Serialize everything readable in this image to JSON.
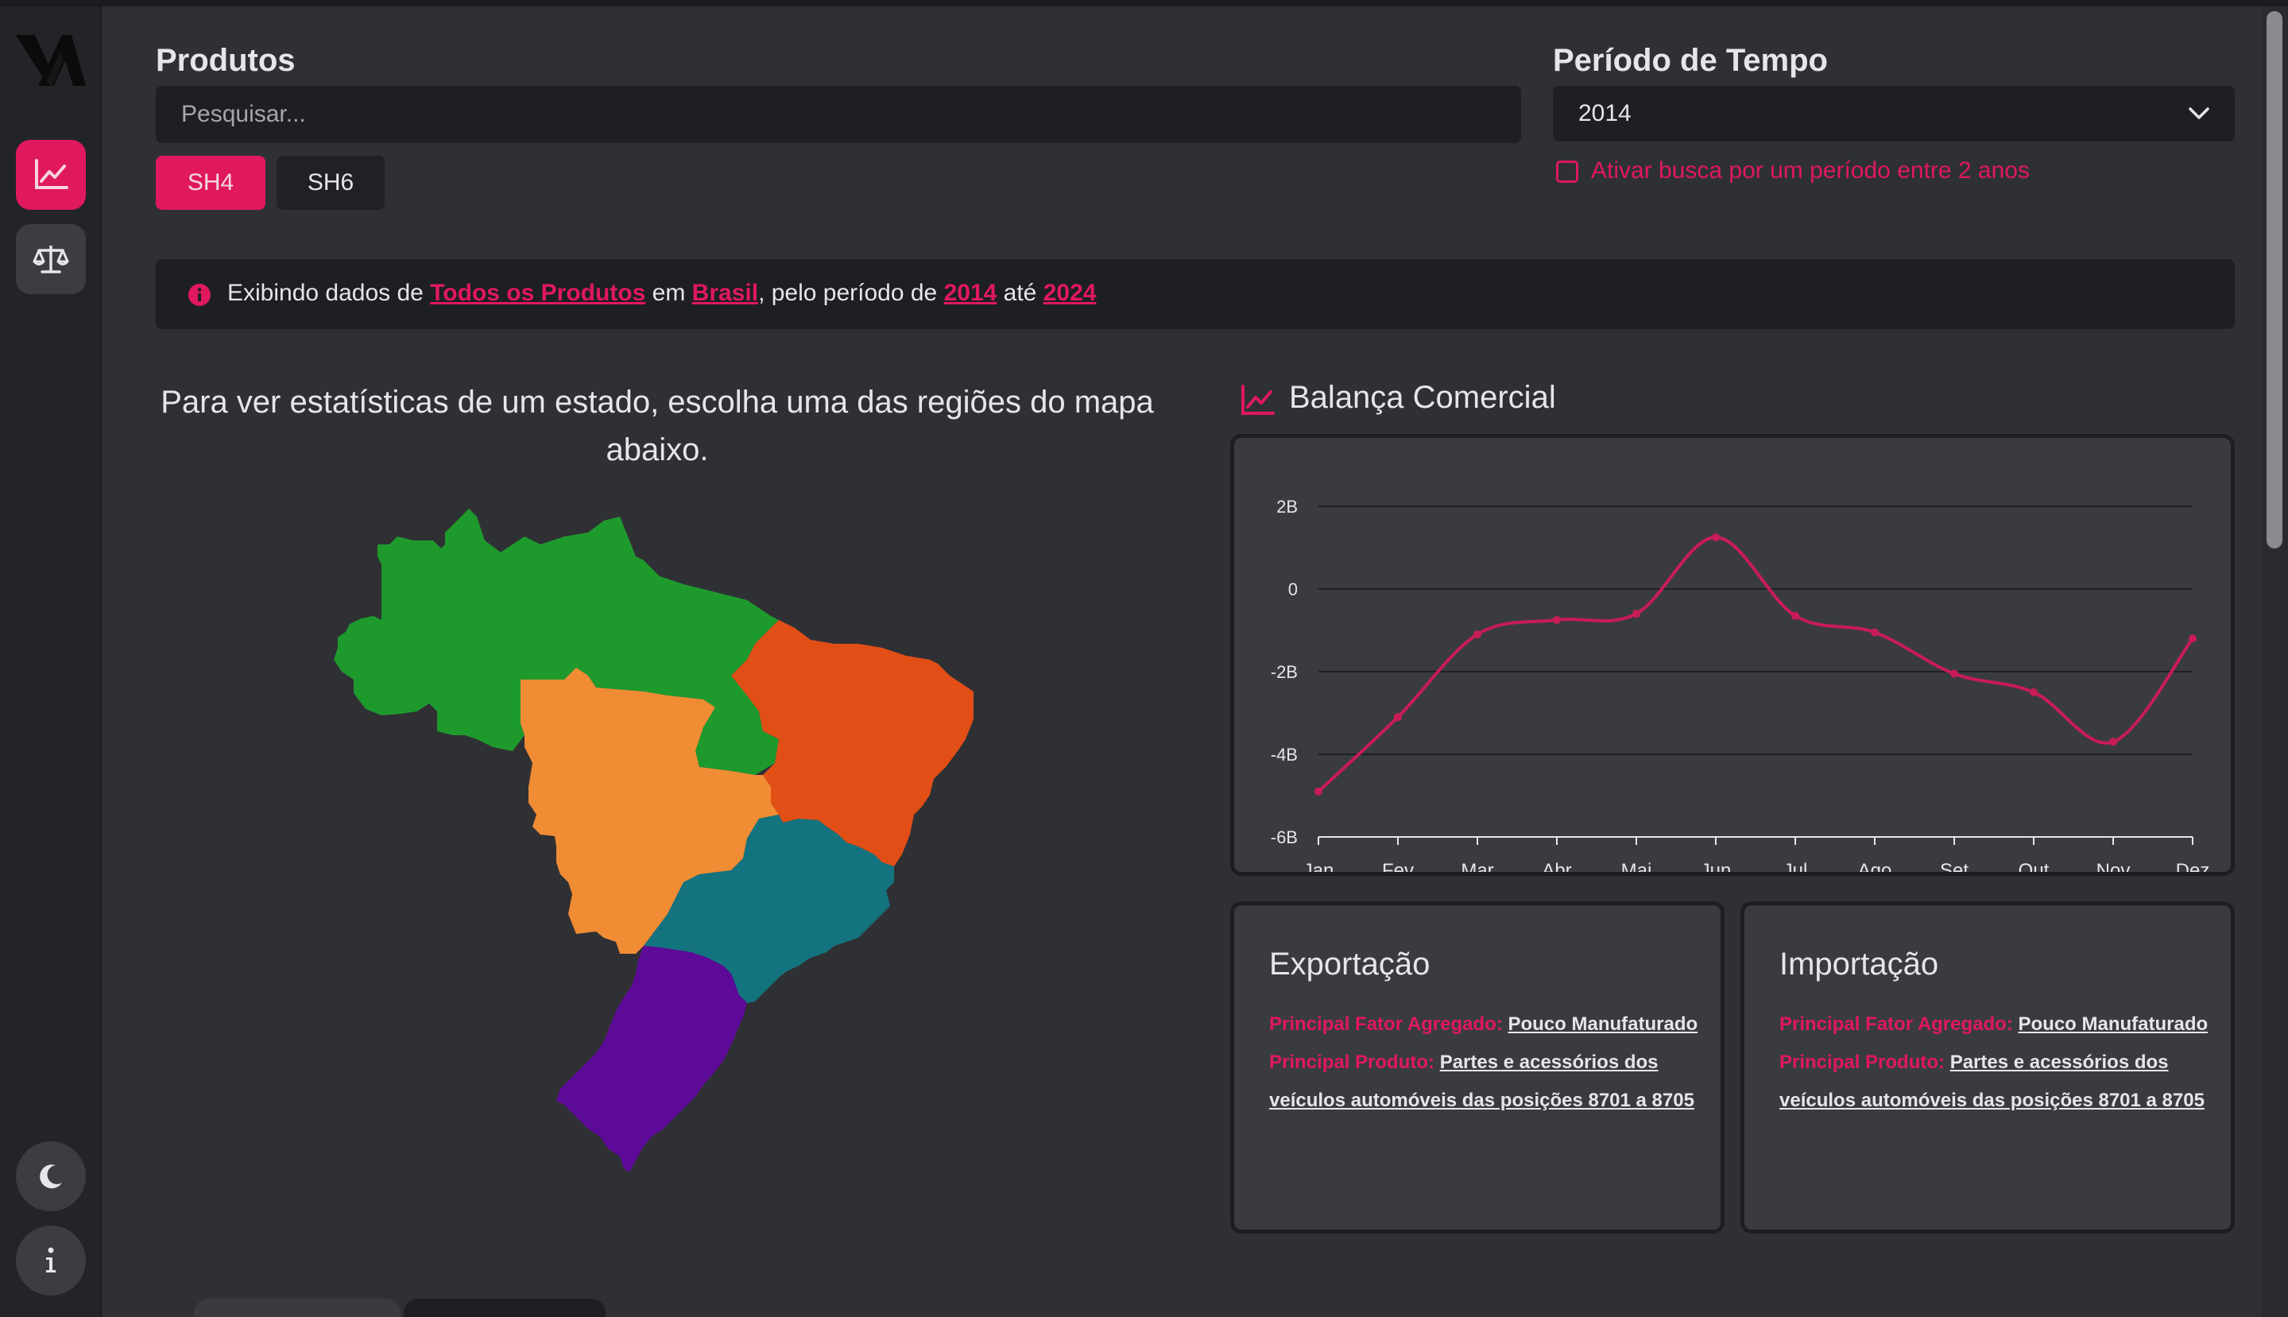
{
  "produtos": {
    "label": "Produtos",
    "search_placeholder": "Pesquisar...",
    "toggle": {
      "sh4": "SH4",
      "sh6": "SH6",
      "selected": "SH4"
    }
  },
  "periodo": {
    "label": "Período de Tempo",
    "selected": "2014",
    "range_checkbox_label": "Ativar busca por um período entre 2 anos",
    "range_checked": false
  },
  "info": {
    "p1": "Exibindo dados de ",
    "produto": "Todos os Produtos",
    "p2": " em ",
    "local": "Brasil",
    "p3": ", pelo período de ",
    "ano_inicio": "2014",
    "p4": " até ",
    "ano_fim": "2024"
  },
  "map": {
    "instruction": "Para ver estatísticas de um estado, escolha uma das regiões do mapa abaixo.",
    "regions": [
      {
        "name": "Norte",
        "color": "#1e9a2d"
      },
      {
        "name": "Nordeste",
        "color": "#e14f16"
      },
      {
        "name": "Centro-Oeste",
        "color": "#f08c34"
      },
      {
        "name": "Sudeste",
        "color": "#13737f"
      },
      {
        "name": "Sul",
        "color": "#5e0a99"
      }
    ]
  },
  "balanca": {
    "title": "Balança Comercial"
  },
  "chart_data": {
    "type": "line",
    "title": "Balança Comercial",
    "categories": [
      "Jan",
      "Fev",
      "Mar",
      "Abr",
      "Mai",
      "Jun",
      "Jul",
      "Ago",
      "Set",
      "Out",
      "Nov",
      "Dez"
    ],
    "series": [
      {
        "values": [
          -4.9,
          -3.1,
          -1.1,
          -0.75,
          -0.6,
          1.25,
          -0.65,
          -1.05,
          -2.05,
          -2.5,
          -3.7,
          -1.2
        ],
        "color": "#c91c57"
      }
    ],
    "ylim": [
      -6,
      2
    ],
    "yticks": [
      2,
      0,
      -2,
      -4,
      -6
    ],
    "ytick_labels": [
      "2B",
      "0",
      "-2B",
      "-4B",
      "-6B"
    ],
    "grid": true,
    "xlabel": "",
    "ylabel": ""
  },
  "exportacao": {
    "title": "Exportação",
    "fator_label": "Principal Fator Agregado: ",
    "fator_value": "Pouco Manufaturado",
    "produto_label": "Principal Produto: ",
    "produto_value": "Partes e acessórios dos veículos automóveis das posições 8701 a 8705"
  },
  "importacao": {
    "title": "Importação",
    "fator_label": "Principal Fator Agregado: ",
    "fator_value": "Pouco Manufaturado",
    "produto_label": "Principal Produto: ",
    "produto_value": "Partes e acessórios dos veículos automóveis das posições 8701 a 8705"
  },
  "colors": {
    "accent": "#e0185e",
    "background": "#2f3034",
    "card": "#3a3b40"
  },
  "sidebar": {
    "items": [
      {
        "icon": "line-chart-icon",
        "active": true
      },
      {
        "icon": "scale-icon",
        "active": false
      }
    ],
    "bottom": [
      {
        "icon": "moon-icon"
      },
      {
        "icon": "info-icon"
      }
    ]
  }
}
